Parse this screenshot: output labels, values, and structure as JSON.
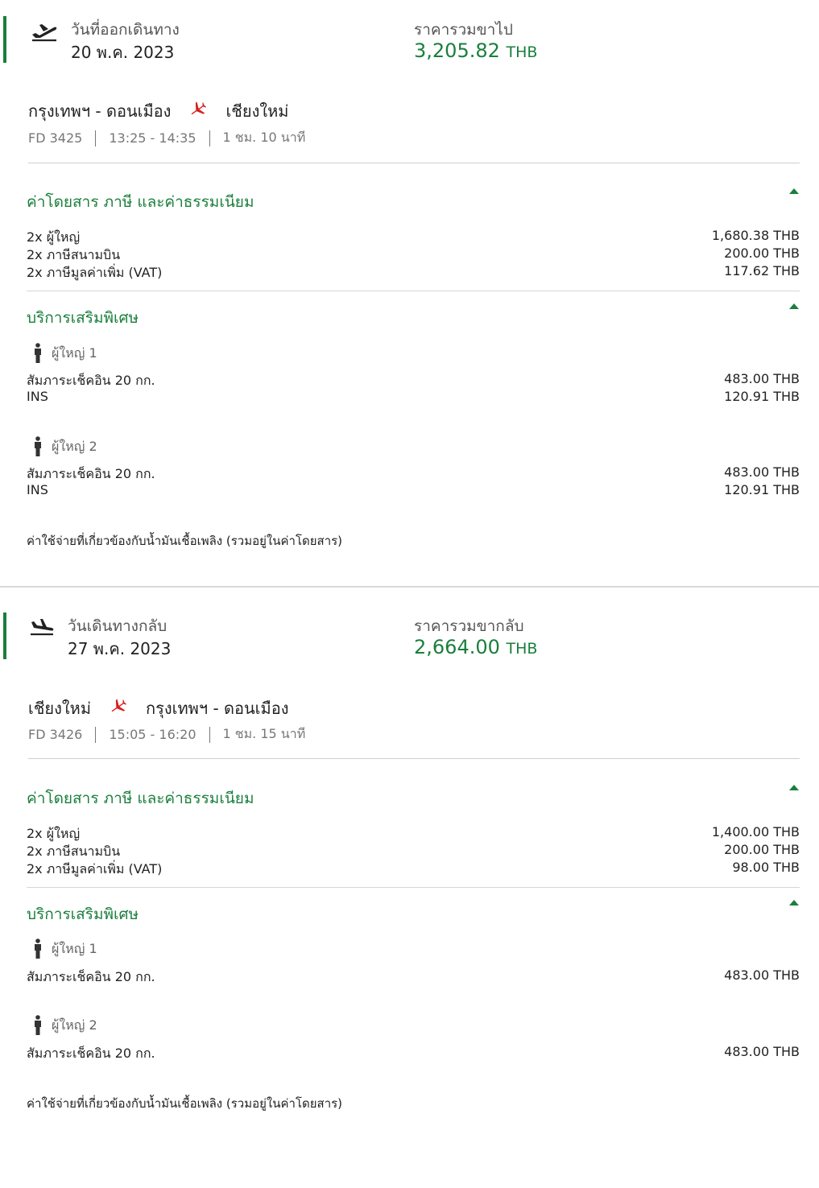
{
  "colors": {
    "accent": "#1a7f3c",
    "plane": "#d81e1e",
    "muted": "#777777"
  },
  "outbound": {
    "date_label": "วันที่ออกเดินทาง",
    "date_value": "20 พ.ค. 2023",
    "total_label": "ราคารวมขาไป",
    "total_amount": "3,205.82",
    "total_currency": "THB",
    "origin": "กรุงเทพฯ - ดอนเมือง",
    "destination": "เชียงใหม่",
    "flight_no": "FD 3425",
    "time": "13:25 - 14:35",
    "duration": "1 ชม. 10 นาที",
    "fares_title": "ค่าโดยสาร ภาษี และค่าธรรมเนียม",
    "fares": [
      {
        "label": "2x ผู้ใหญ่",
        "amount": "1,680.38 THB"
      },
      {
        "label": "2x ภาษีสนามบิน",
        "amount": "200.00 THB"
      },
      {
        "label": "2x ภาษีมูลค่าเพิ่ม (VAT)",
        "amount": "117.62 THB"
      }
    ],
    "extras_title": "บริการเสริมพิเศษ",
    "passengers": [
      {
        "name": "ผู้ใหญ่ 1",
        "items": [
          {
            "label": "สัมภาระเช็คอิน 20 กก.",
            "amount": "483.00 THB"
          },
          {
            "label": "INS",
            "amount": "120.91 THB"
          }
        ]
      },
      {
        "name": "ผู้ใหญ่ 2",
        "items": [
          {
            "label": "สัมภาระเช็คอิน 20 กก.",
            "amount": "483.00 THB"
          },
          {
            "label": "INS",
            "amount": "120.91 THB"
          }
        ]
      }
    ],
    "fuel_note": "ค่าใช้จ่ายที่เกี่ยวข้องกับน้ำมันเชื้อเพลิง (รวมอยู่ในค่าโดยสาร)"
  },
  "return": {
    "date_label": "วันเดินทางกลับ",
    "date_value": "27 พ.ค. 2023",
    "total_label": "ราคารวมขากลับ",
    "total_amount": "2,664.00",
    "total_currency": "THB",
    "origin": "เชียงใหม่",
    "destination": "กรุงเทพฯ - ดอนเมือง",
    "flight_no": "FD 3426",
    "time": "15:05 - 16:20",
    "duration": "1 ชม. 15 นาที",
    "fares_title": "ค่าโดยสาร ภาษี และค่าธรรมเนียม",
    "fares": [
      {
        "label": "2x ผู้ใหญ่",
        "amount": "1,400.00 THB"
      },
      {
        "label": "2x ภาษีสนามบิน",
        "amount": "200.00 THB"
      },
      {
        "label": "2x ภาษีมูลค่าเพิ่ม (VAT)",
        "amount": "98.00 THB"
      }
    ],
    "extras_title": "บริการเสริมพิเศษ",
    "passengers": [
      {
        "name": "ผู้ใหญ่ 1",
        "items": [
          {
            "label": "สัมภาระเช็คอิน 20 กก.",
            "amount": "483.00 THB"
          }
        ]
      },
      {
        "name": "ผู้ใหญ่ 2",
        "items": [
          {
            "label": "สัมภาระเช็คอิน 20 กก.",
            "amount": "483.00 THB"
          }
        ]
      }
    ],
    "fuel_note": "ค่าใช้จ่ายที่เกี่ยวข้องกับน้ำมันเชื้อเพลิง (รวมอยู่ในค่าโดยสาร)"
  }
}
